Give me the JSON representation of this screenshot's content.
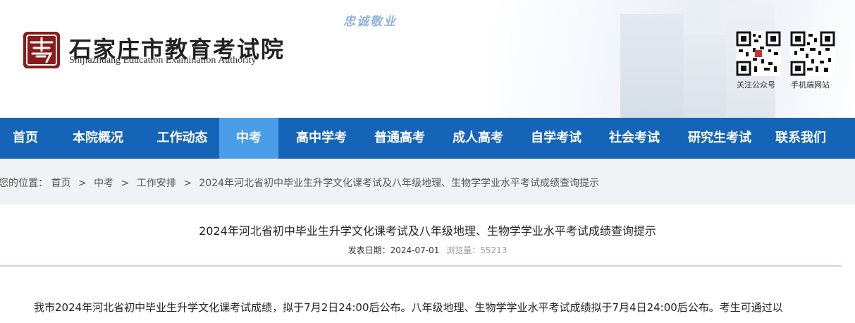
{
  "header": {
    "slogan": "忠诚敬业",
    "site_title": "石家庄市教育考试院",
    "site_subtitle": "Shijiazhuang Education Examination Authority",
    "qr_codes": [
      {
        "label": "关注公众号",
        "icon": "wechat-qr-icon"
      },
      {
        "label": "手机端网站",
        "icon": "mobile-site-qr-icon"
      }
    ],
    "colors": {
      "brand_red": "#8b1a1a",
      "nav_blue": "#1464b8",
      "nav_active": "#4a9de8"
    }
  },
  "nav": {
    "items": [
      {
        "label": "首页"
      },
      {
        "label": "本院概况"
      },
      {
        "label": "工作动态"
      },
      {
        "label": "中考"
      },
      {
        "label": "高中学考"
      },
      {
        "label": "普通高考"
      },
      {
        "label": "成人高考"
      },
      {
        "label": "自学考试"
      },
      {
        "label": "社会考试"
      },
      {
        "label": "研究生考试"
      },
      {
        "label": "联系我们"
      }
    ],
    "active": "中考"
  },
  "breadcrumb": {
    "prefix": "您的位置：",
    "items": [
      "首页",
      "中考",
      "工作安排",
      "2024年河北省初中毕业生升学文化课考试及八年级地理、生物学学业水平考试成绩查询提示"
    ],
    "separator": ">"
  },
  "article": {
    "title": "2024年河北省初中毕业生升学文化课考试及八年级地理、生物学学业水平考试成绩查询提示",
    "date_label": "发表日期：",
    "date": "2024-07-01",
    "views_label": "浏览量：",
    "views": "55213",
    "body_first_line": "我市2024年河北省初中毕业生升学文化课考试成绩，拟于7月2日24:00后公布。八年级地理、生物学学业水平考试成绩拟于7月4日24:00后公布。考生可通过以"
  }
}
